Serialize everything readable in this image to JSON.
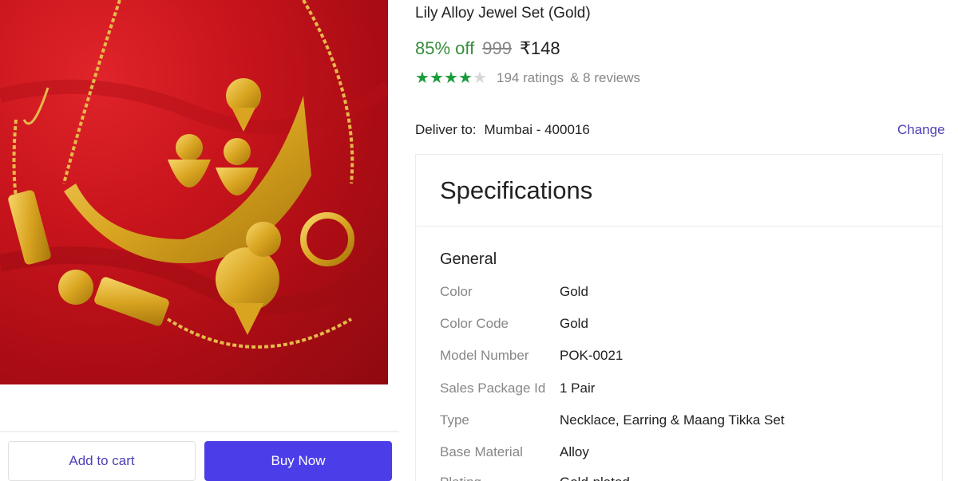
{
  "product": {
    "title": "Lily Alloy Jewel Set (Gold)",
    "discount": "85% off",
    "mrp": "999",
    "price": "₹148",
    "rating_stars": 4,
    "ratings": "194 ratings",
    "reviews": "& 8 reviews"
  },
  "delivery": {
    "label": "Deliver to:",
    "location": "Mumbai - 400016",
    "change_label": "Change"
  },
  "actions": {
    "add_to_cart": "Add to cart",
    "buy_now": "Buy Now"
  },
  "specifications": {
    "title": "Specifications",
    "group": "General",
    "rows": [
      {
        "key": "Color",
        "value": "Gold"
      },
      {
        "key": "Color Code",
        "value": "Gold"
      },
      {
        "key": "Model Number",
        "value": "POK-0021"
      },
      {
        "key": "Sales Package Id",
        "value": "1 Pair"
      },
      {
        "key": "Type",
        "value": "Necklace, Earring & Maang Tikka Set"
      },
      {
        "key": "Base Material",
        "value": "Alloy"
      },
      {
        "key": "Plating",
        "value": "Gold-plated"
      }
    ]
  },
  "colors": {
    "accent": "#4b3ee8",
    "link": "#4b3fb8",
    "discount_green": "#388e3c",
    "star_green": "#1a9c3a",
    "image_background_red": "#c8141c"
  }
}
